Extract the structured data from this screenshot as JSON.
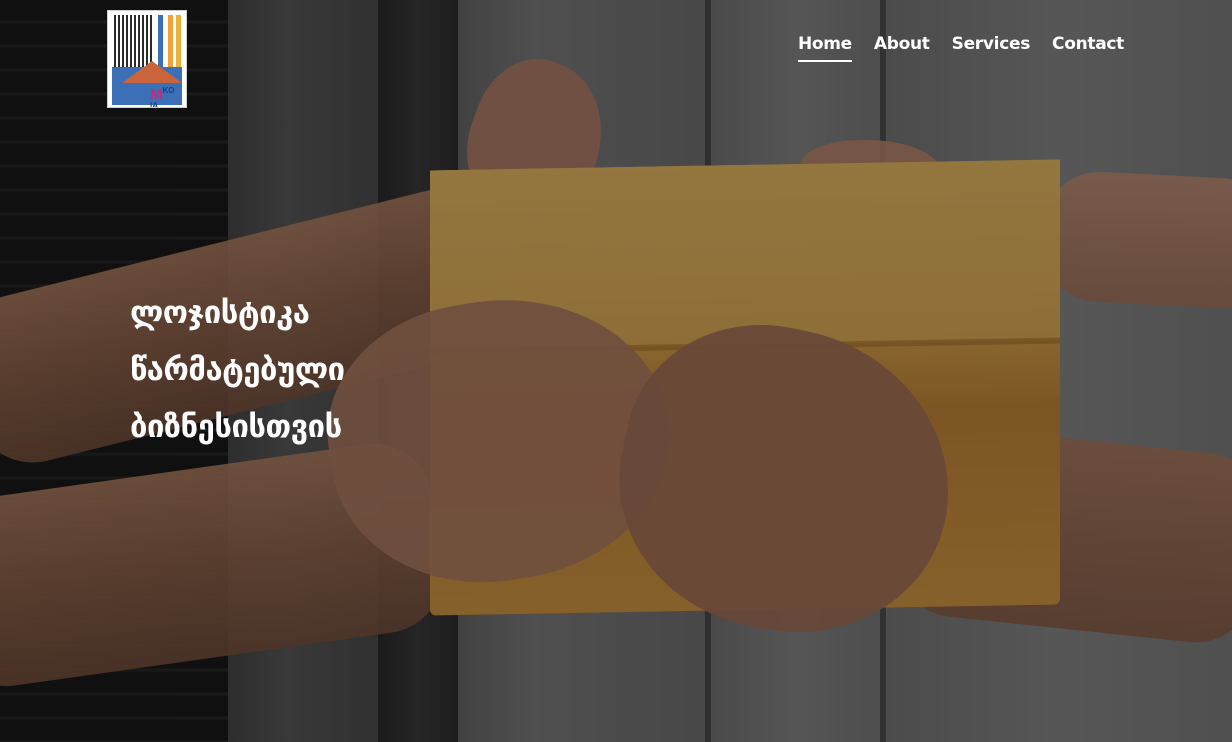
{
  "logo": {
    "letters_main": "M",
    "letters_small": "KO",
    "letters_bottom": "IA",
    "icon": "building-house-logo"
  },
  "nav": {
    "items": [
      {
        "label": "Home",
        "active": true
      },
      {
        "label": "About",
        "active": false
      },
      {
        "label": "Services",
        "active": false
      },
      {
        "label": "Contact",
        "active": false
      }
    ]
  },
  "hero": {
    "headline_lines": [
      "ლოჯისტიკა",
      "წარმატებული",
      "ბიზნესისთვის"
    ],
    "image": "hands-passing-cardboard-box"
  }
}
